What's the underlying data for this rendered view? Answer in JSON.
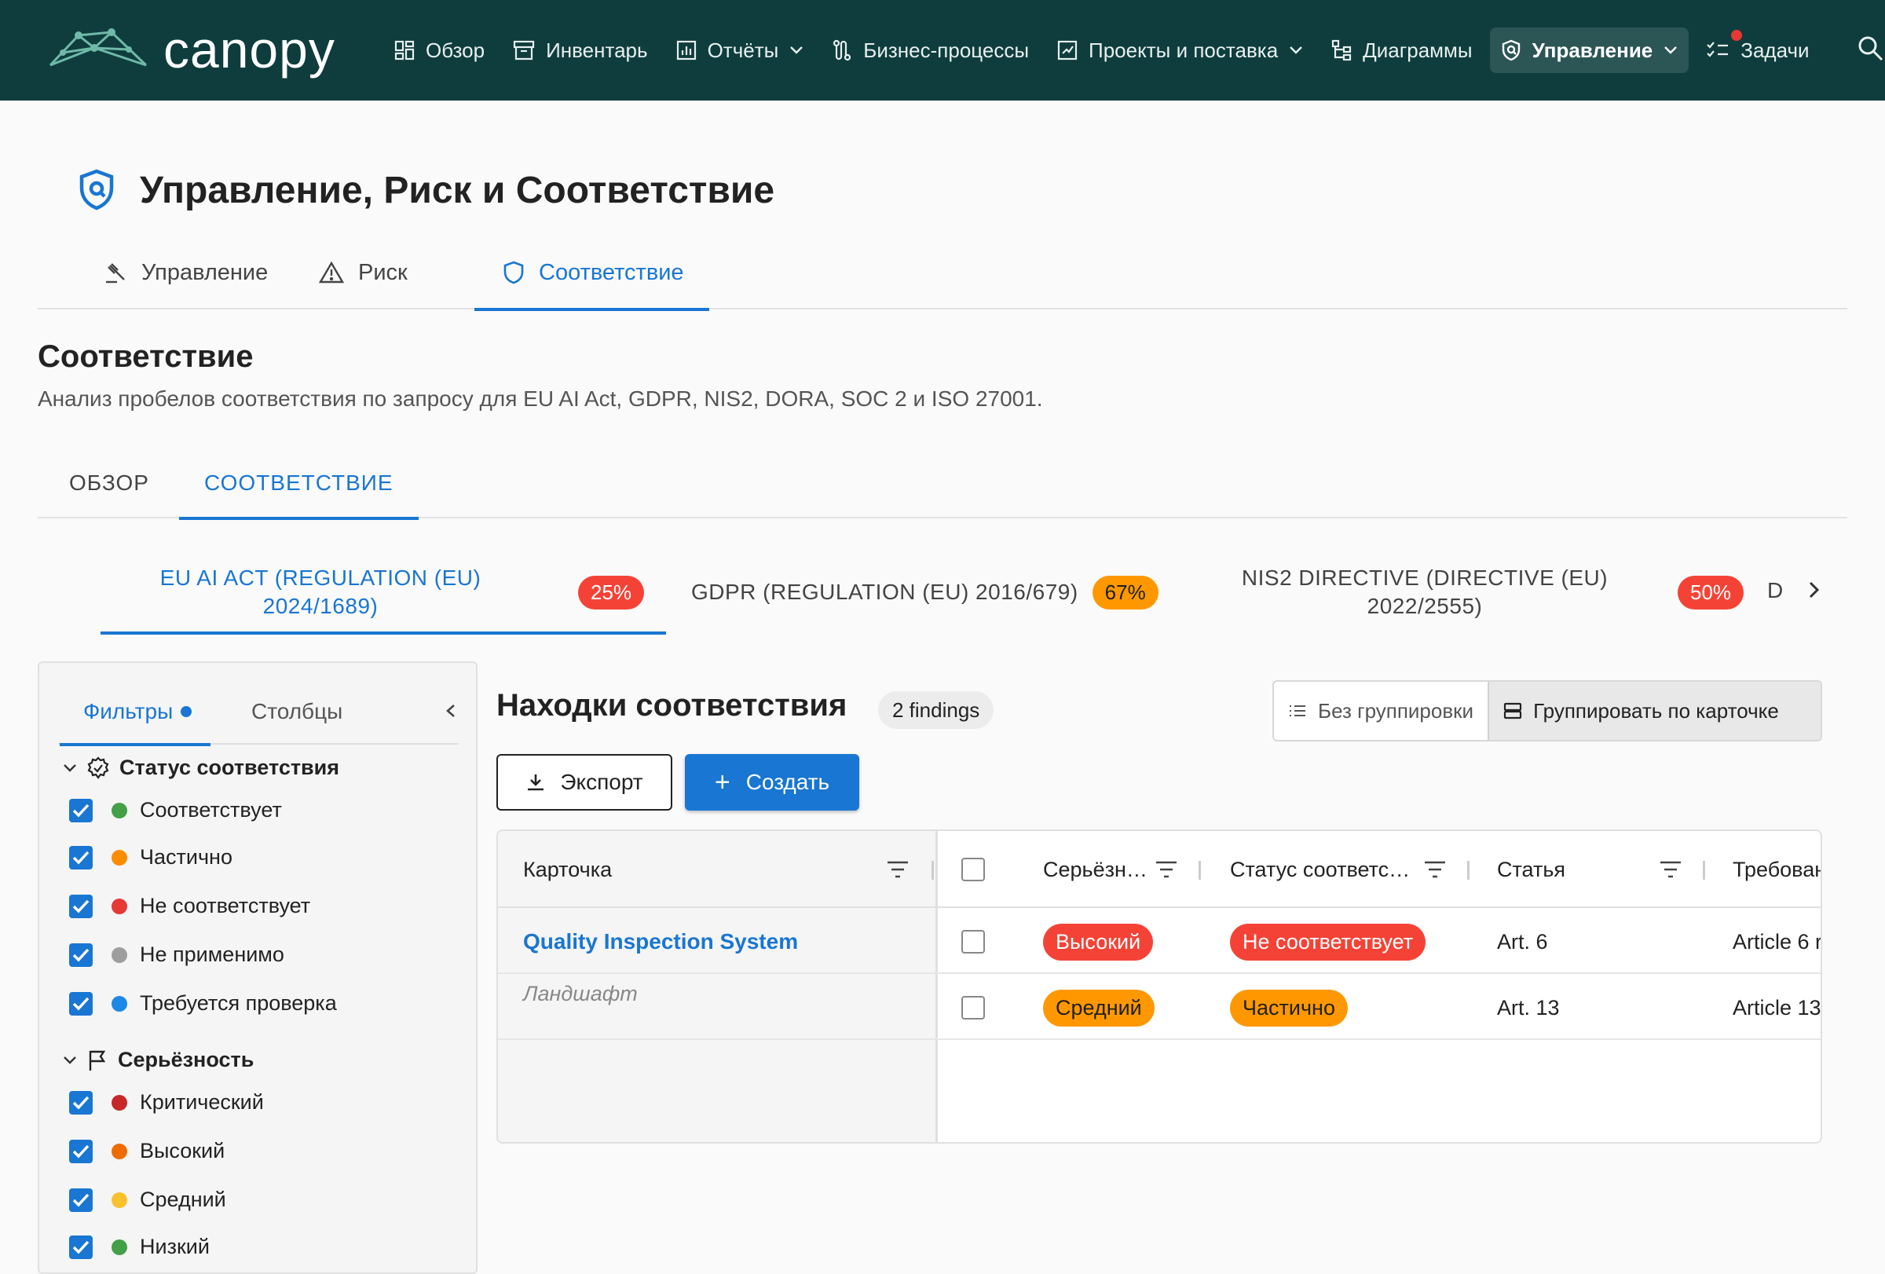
{
  "app": {
    "name": "canopy"
  },
  "nav": {
    "items": [
      {
        "label": "Обзор",
        "icon": "dashboard-icon"
      },
      {
        "label": "Инвентарь",
        "icon": "inventory-icon"
      },
      {
        "label": "Отчёты",
        "icon": "reports-icon",
        "dropdown": true
      },
      {
        "label": "Бизнес-процессы",
        "icon": "process-icon"
      },
      {
        "label": "Проекты и поставка",
        "icon": "projects-icon",
        "dropdown": true
      },
      {
        "label": "Диаграммы",
        "icon": "diagram-icon"
      },
      {
        "label": "Управление",
        "icon": "governance-icon",
        "dropdown": true,
        "active": true
      },
      {
        "label": "Задачи",
        "icon": "tasks-icon",
        "notification": true
      }
    ]
  },
  "page": {
    "title": "Управление, Риск и Соответствие"
  },
  "section_tabs": [
    {
      "label": "Управление",
      "icon": "gavel-icon"
    },
    {
      "label": "Риск",
      "icon": "warning-icon"
    },
    {
      "label": "Соответствие",
      "icon": "shield-icon",
      "active": true
    }
  ],
  "compliance": {
    "title": "Соответствие",
    "subtitle": "Анализ пробелов соответствия по запросу для EU AI Act, GDPR, NIS2, DORA, SOC 2 и ISO 27001."
  },
  "sub_tabs": [
    {
      "label": "ОБЗОР"
    },
    {
      "label": "СООТВЕТСТВИЕ",
      "active": true
    }
  ],
  "frameworks": [
    {
      "label_line1": "EU AI ACT (REGULATION (EU)",
      "label_line2": "2024/1689)",
      "percent": "25%",
      "color": "#f44336",
      "active": true
    },
    {
      "label_line1": "GDPR (REGULATION (EU) 2016/679)",
      "label_line2": "",
      "percent": "67%",
      "color": "#ff9800"
    },
    {
      "label_line1": "NIS2 DIRECTIVE (DIRECTIVE (EU)",
      "label_line2": "2022/2555)",
      "percent": "50%",
      "color": "#f44336"
    },
    {
      "label_line1": "D",
      "label_line2": ""
    }
  ],
  "filters": {
    "tab_filters": "Фильтры",
    "tab_columns": "Столбцы",
    "groups": [
      {
        "title": "Статус соответствия",
        "icon": "badge-check-icon",
        "options": [
          {
            "label": "Соответствует",
            "color": "#43a047",
            "checked": true
          },
          {
            "label": "Частично",
            "color": "#fb8c00",
            "checked": true
          },
          {
            "label": "Не соответствует",
            "color": "#e53935",
            "checked": true
          },
          {
            "label": "Не применимо",
            "color": "#9e9e9e",
            "checked": true
          },
          {
            "label": "Требуется проверка",
            "color": "#1e88e5",
            "checked": true
          }
        ]
      },
      {
        "title": "Серьёзность",
        "icon": "flag-icon",
        "options": [
          {
            "label": "Критический",
            "color": "#c62828",
            "checked": true
          },
          {
            "label": "Высокий",
            "color": "#ef6c00",
            "checked": true
          },
          {
            "label": "Средний",
            "color": "#fbc02d",
            "checked": true
          },
          {
            "label": "Низкий",
            "color": "#43a047",
            "checked": true
          }
        ]
      }
    ]
  },
  "findings": {
    "title": "Находки соответствия",
    "count": "2 findings",
    "group_none": "Без группировки",
    "group_by_card": "Группировать по карточке",
    "export_label": "Экспорт",
    "create_label": "Создать",
    "columns": {
      "card": "Карточка",
      "severity": "Серьёзн…",
      "status": "Статус соответс…",
      "article": "Статья",
      "requirement": "Требован"
    },
    "card_group": {
      "name": "Quality Inspection System",
      "type": "Ландшафт"
    },
    "rows": [
      {
        "severity": "Высокий",
        "severity_color": "#f44336",
        "status": "Не соответствует",
        "status_color": "#f44336",
        "article": "Art. 6",
        "requirement": "Article 6 r"
      },
      {
        "severity": "Средний",
        "severity_color": "#ff9800",
        "status": "Частично",
        "status_color": "#ff9800",
        "article": "Art. 13",
        "requirement": "Article 13"
      }
    ]
  }
}
